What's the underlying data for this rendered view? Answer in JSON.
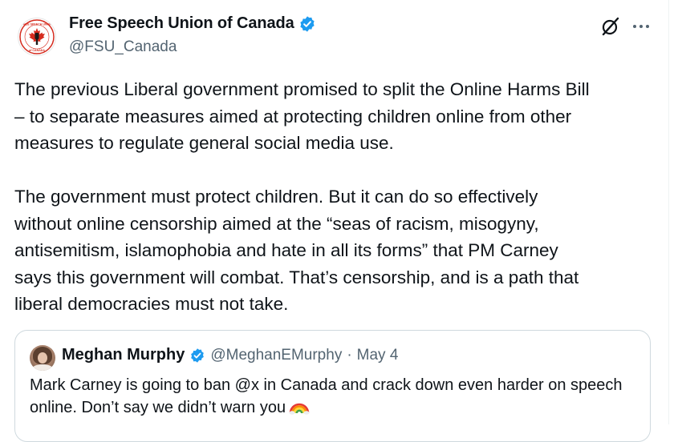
{
  "author": {
    "display_name": "Free Speech Union of Canada",
    "handle": "@FSU_Canada",
    "avatar_text": "FREE SPEECH UNION of CANADA",
    "verified_color": "#1d9bf0"
  },
  "tweet": {
    "text": "The previous Liberal government promised to split the Online Harms Bill\n– to separate measures aimed at protecting children online from other\nmeasures to regulate general social media use.\n\nThe government must protect children. But it can do so effectively\nwithout online censorship aimed at the “seas of racism, misogyny,\nantisemitism, islamophobia and hate in all its forms” that PM Carney\nsays this government will combat. That’s censorship, and is a path that\nliberal democracies must not take."
  },
  "quote": {
    "display_name": "Meghan Murphy",
    "handle": "@MeghanEMurphy",
    "separator": "·",
    "date": "May 4",
    "text": "Mark Carney is going to ban @x in Canada and crack down even harder on speech online. Don’t say we didn’t warn you",
    "emoji_icon": "rainbow-icon"
  },
  "icons": {
    "grok": "grok-icon",
    "more": "more-icon"
  },
  "colors": {
    "text": "#0f1419",
    "secondary": "#536471",
    "border": "#cfd9de",
    "verified": "#1d9bf0",
    "logo_red": "#d52b1e"
  }
}
